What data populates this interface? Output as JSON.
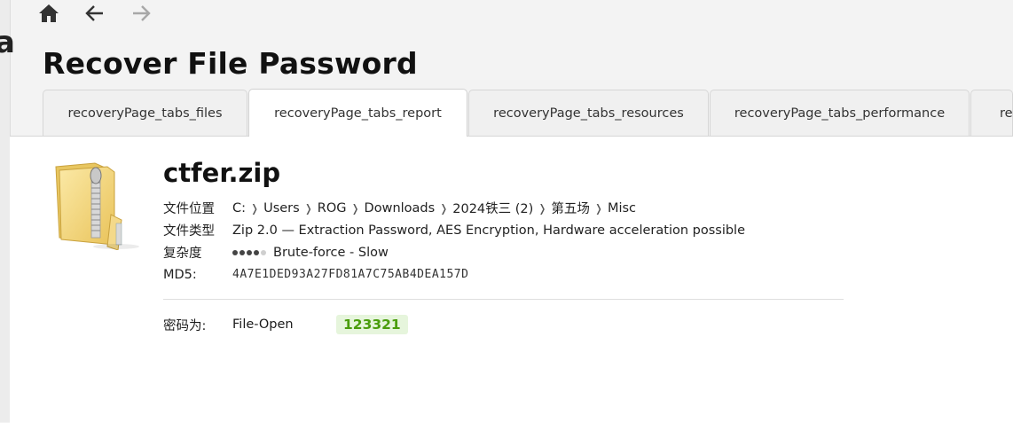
{
  "page": {
    "partial_letter": "a",
    "title": "Recover File Password"
  },
  "nav": {
    "icons": [
      "home-icon",
      "back-arrow-icon",
      "forward-arrow-icon"
    ]
  },
  "tabs": [
    {
      "label": "recoveryPage_tabs_files",
      "active": false
    },
    {
      "label": "recoveryPage_tabs_report",
      "active": true
    },
    {
      "label": "recoveryPage_tabs_resources",
      "active": false
    },
    {
      "label": "recoveryPage_tabs_performance",
      "active": false
    },
    {
      "label": "rec",
      "active": false
    }
  ],
  "file": {
    "icon": "zip-folder-icon",
    "name": "ctfer.zip",
    "location_label": "文件位置",
    "path": [
      "C:",
      "Users",
      "ROG",
      "Downloads",
      "2024铁三 (2)",
      "第五场",
      "Misc"
    ],
    "type_label": "文件类型",
    "type_value": "Zip 2.0 — Extraction Password, AES Encryption, Hardware acceleration possible",
    "complexity_label": "复杂度",
    "complexity_level": 4,
    "complexity_max": 5,
    "complexity_value": "Brute-force - Slow",
    "md5_label": "MD5:",
    "md5_value": "4A7E1DED93A27FD81A7C75AB4DEA157D"
  },
  "result": {
    "label": "密码为:",
    "method": "File-Open",
    "password": "123321"
  },
  "colors": {
    "password_bg": "#e6f5dc",
    "password_text": "#4a9d0c"
  }
}
